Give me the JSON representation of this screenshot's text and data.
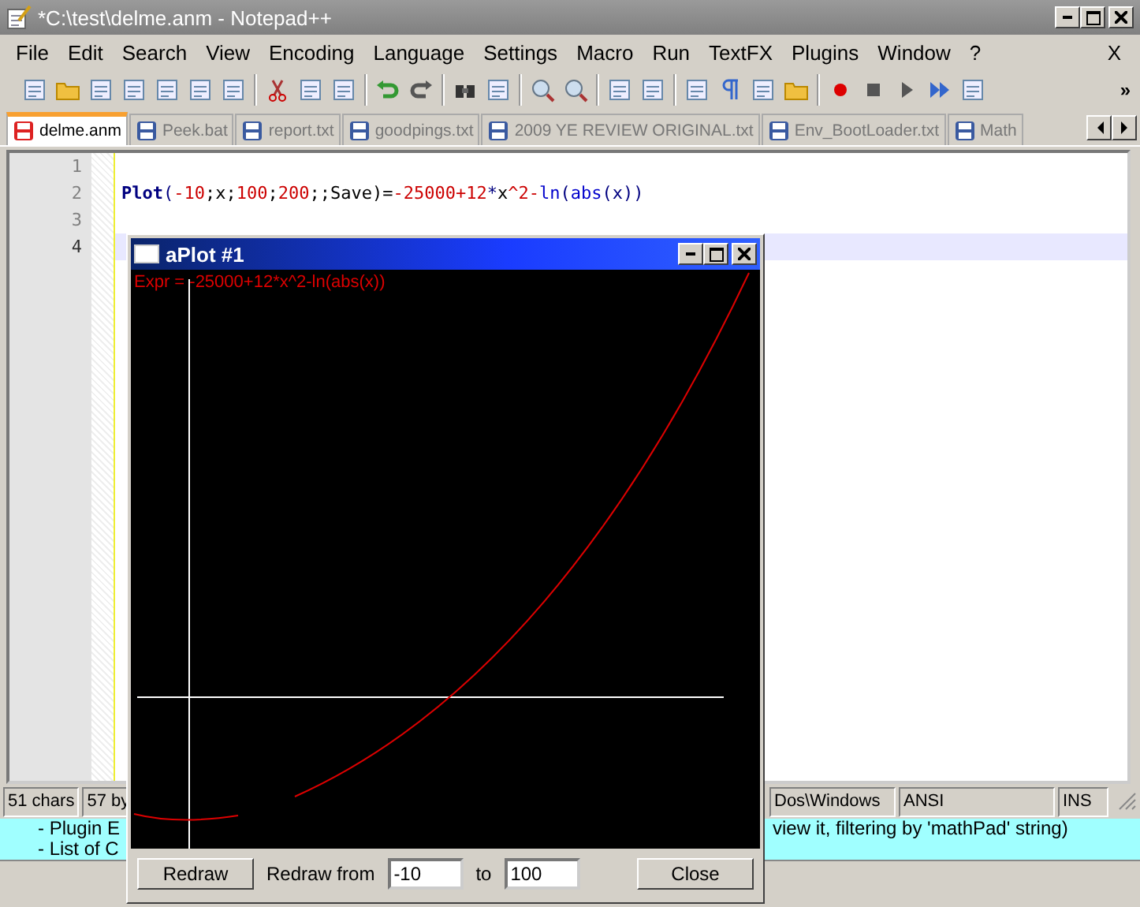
{
  "window": {
    "title": "*C:\\test\\delme.anm - Notepad++"
  },
  "menu": [
    "File",
    "Edit",
    "Search",
    "View",
    "Encoding",
    "Language",
    "Settings",
    "Macro",
    "Run",
    "TextFX",
    "Plugins",
    "Window",
    "?"
  ],
  "menu_close": "X",
  "toolbar_more": "»",
  "tabs": [
    {
      "label": "delme.anm",
      "selected": true,
      "modified": true
    },
    {
      "label": "Peek.bat",
      "selected": false,
      "modified": false
    },
    {
      "label": "report.txt",
      "selected": false,
      "modified": false
    },
    {
      "label": "goodpings.txt",
      "selected": false,
      "modified": false
    },
    {
      "label": "2009 YE REVIEW ORIGINAL.txt",
      "selected": false,
      "modified": false
    },
    {
      "label": "Env_BootLoader.txt",
      "selected": false,
      "modified": false
    },
    {
      "label": "Math",
      "selected": false,
      "modified": false
    }
  ],
  "editor": {
    "lines": [
      {
        "number": "1",
        "current": false
      },
      {
        "number": "2",
        "current": false,
        "tokens": [
          {
            "kind": "keyword",
            "text": "Plot"
          },
          {
            "kind": "operator",
            "text": "("
          },
          {
            "kind": "number",
            "text": "-10"
          },
          {
            "kind": "plain",
            "text": ";x;"
          },
          {
            "kind": "number",
            "text": "100"
          },
          {
            "kind": "plain",
            "text": ";"
          },
          {
            "kind": "number",
            "text": "200"
          },
          {
            "kind": "plain",
            "text": ";;Save)="
          },
          {
            "kind": "number",
            "text": "-25000+12"
          },
          {
            "kind": "operator",
            "text": "*"
          },
          {
            "kind": "plain",
            "text": "x"
          },
          {
            "kind": "number",
            "text": "^2-"
          },
          {
            "kind": "function",
            "text": "ln"
          },
          {
            "kind": "operator",
            "text": "("
          },
          {
            "kind": "function",
            "text": "abs"
          },
          {
            "kind": "operator",
            "text": "(x))"
          }
        ]
      },
      {
        "number": "3",
        "current": false
      },
      {
        "number": "4",
        "current": true
      }
    ]
  },
  "status_bar": [
    "51 chars",
    "57 by",
    "Dos\\Windows",
    "ANSI",
    "INS"
  ],
  "background_text": {
    "left": [
      "- Plugin E",
      "- List of C"
    ],
    "right": "view it, filtering by 'mathPad' string)"
  },
  "plot_window": {
    "title": "aPlot #1",
    "expression": "Expr = -25000+12*x^2-ln(abs(x))",
    "redraw_button": "Redraw",
    "range_label": "Redraw from",
    "from": "-10",
    "to_label": "to",
    "to": "100",
    "close_button": "Close"
  }
}
